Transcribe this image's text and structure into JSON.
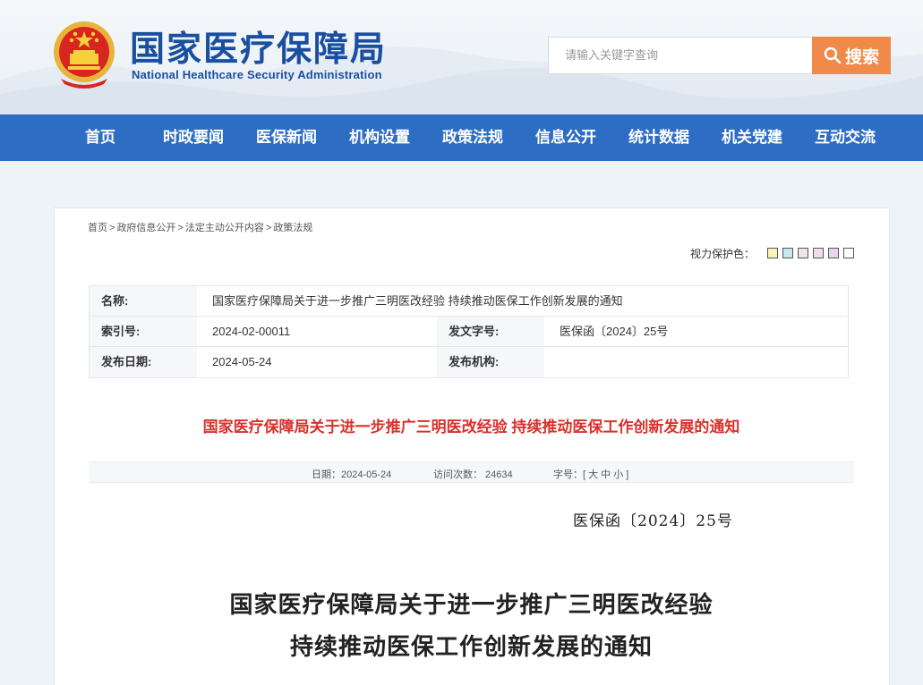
{
  "header": {
    "title": "国家医疗保障局",
    "subtitle": "National Healthcare Security Administration",
    "search_placeholder": "请输入关键字查询",
    "search_button": "搜索"
  },
  "nav": {
    "items": [
      {
        "label": "首页"
      },
      {
        "label": "时政要闻"
      },
      {
        "label": "医保新闻"
      },
      {
        "label": "机构设置"
      },
      {
        "label": "政策法规"
      },
      {
        "label": "信息公开"
      },
      {
        "label": "统计数据"
      },
      {
        "label": "机关党建"
      },
      {
        "label": "互动交流"
      }
    ]
  },
  "breadcrumb": {
    "items": [
      "首页",
      "政府信息公开",
      "法定主动公开内容",
      "政策法规"
    ],
    "separator": ">"
  },
  "eye_protection": {
    "label": "视力保护色：",
    "swatches": [
      "#fbf4b8",
      "#c9e6f3",
      "#f3e3e6",
      "#f5dde8",
      "#e5d4f3",
      "#ffffff"
    ]
  },
  "meta": {
    "name_label": "名称:",
    "name_value": "国家医疗保障局关于进一步推广三明医改经验 持续推动医保工作创新发展的通知",
    "index_label": "索引号:",
    "index_value": "2024-02-00011",
    "docno_label": "发文字号:",
    "docno_value": "医保函〔2024〕25号",
    "date_label": "发布日期:",
    "date_value": "2024-05-24",
    "org_label": "发布机构:",
    "org_value": ""
  },
  "article": {
    "headline": "国家医疗保障局关于进一步推广三明医改经验 持续推动医保工作创新发展的通知",
    "date_text": "日期：2024-05-24",
    "visits_text": "访问次数： 24634",
    "font_size_text": "字号：[ 大 中 小 ]",
    "doc_number": "医保函〔2024〕25号",
    "title_line1": "国家医疗保障局关于进一步推广三明医改经验",
    "title_line2": "持续推动医保工作创新发展的通知"
  }
}
